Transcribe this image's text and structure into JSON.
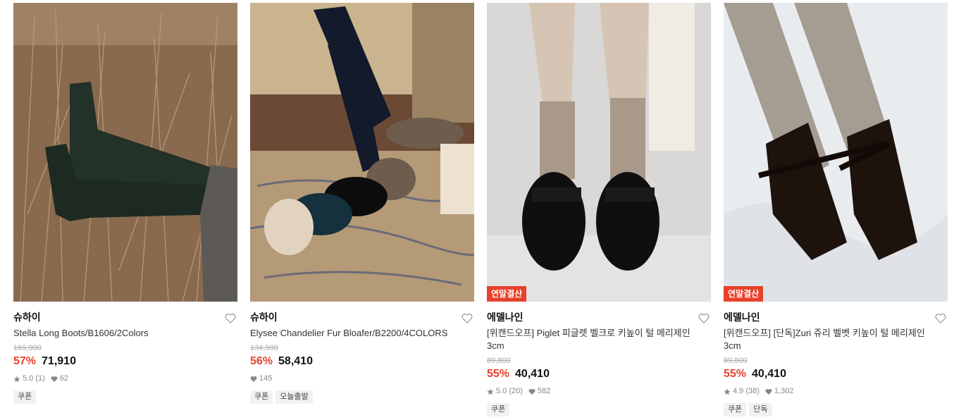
{
  "products": [
    {
      "brand": "슈하이",
      "name": "Stella Long Boots/B1606/2Colors",
      "original_price": "169,900",
      "discount": "57%",
      "price": "71,910",
      "rating": "5.0 (1)",
      "likes": "62",
      "tags": [
        "쿠폰"
      ],
      "badge": "",
      "image_icon": "long-black-boots-photo"
    },
    {
      "brand": "슈하이",
      "name": "Elysee Chandelier Fur Bloafer/B2200/4COLORS",
      "original_price": "134,900",
      "discount": "56%",
      "price": "58,410",
      "rating": "",
      "likes": "145",
      "tags": [
        "쿠폰",
        "오늘출발"
      ],
      "badge": "",
      "image_icon": "fur-loafer-photo"
    },
    {
      "brand": "에델나인",
      "name": "[위캔드오프] Piglet 피글렛 벨크로 키높이 털 메리제인 3cm",
      "original_price": "89,800",
      "discount": "55%",
      "price": "40,410",
      "rating": "5.0 (20)",
      "likes": "582",
      "tags": [
        "쿠폰"
      ],
      "badge": "연말결산",
      "image_icon": "black-mary-jane-photo"
    },
    {
      "brand": "에델나인",
      "name": "[위캔드오프] [단독]Zuri 쥬리 벨벳 키높이 털 메리제인 3cm",
      "original_price": "89,800",
      "discount": "55%",
      "price": "40,410",
      "rating": "4.9 (38)",
      "likes": "1,302",
      "tags": [
        "쿠폰",
        "단독"
      ],
      "badge": "연말결산",
      "image_icon": "velvet-mary-jane-photo"
    }
  ],
  "colors": {
    "accent": "#e8412b",
    "badge_bg": "#e8412b"
  }
}
